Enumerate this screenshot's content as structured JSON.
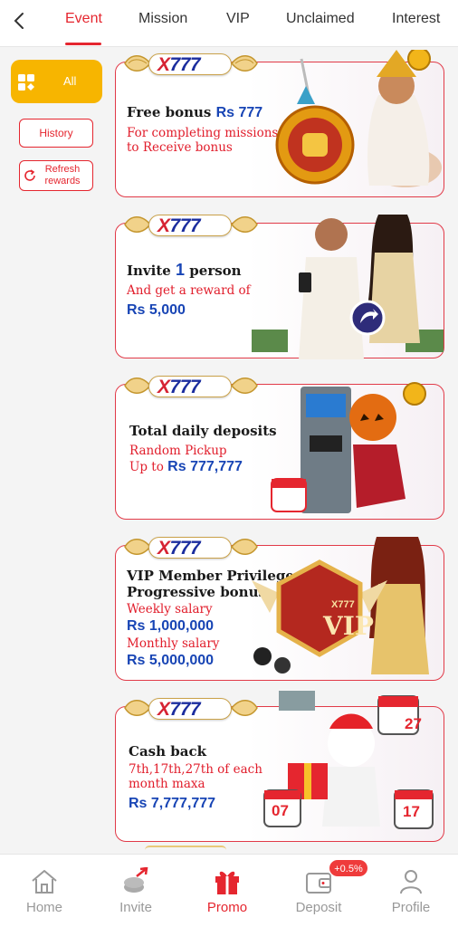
{
  "header": {
    "tabs": [
      {
        "label": "Event",
        "active": true
      },
      {
        "label": "Mission",
        "active": false
      },
      {
        "label": "VIP",
        "active": false
      },
      {
        "label": "Unclaimed",
        "active": false
      },
      {
        "label": "Interest",
        "active": false
      }
    ]
  },
  "sidebar": {
    "all_label": "All",
    "history_label": "History",
    "refresh_label": "Refresh rewards"
  },
  "brand": {
    "prefix": "X",
    "number": "777"
  },
  "cards": [
    {
      "title": "Free bonus",
      "amount": "Rs 777",
      "line1": "For completing missions",
      "line2": "to Receive bonus"
    },
    {
      "title_a": "Invite",
      "count": "1",
      "title_b": "person",
      "line1": "And get a reward of",
      "amount": "Rs 5,000"
    },
    {
      "title": "Total daily deposits",
      "line1": "Random Pickup",
      "line2_prefix": "Up to",
      "amount": "Rs 777,777"
    },
    {
      "title1": "VIP Member Privileges",
      "title2": "Progressive bonus",
      "weekly_label": "Weekly salary",
      "weekly_amount": "Rs 1,000,000",
      "monthly_label": "Monthly salary",
      "monthly_amount": "Rs 5,000,000",
      "badge_brand": "X777",
      "badge_text": "VIP"
    },
    {
      "title": "Cash back",
      "line1": "7th,17th,27th of each",
      "line2": "month maxa",
      "amount": "Rs 7,777,777",
      "cal_dates": [
        "27",
        "07",
        "17"
      ]
    }
  ],
  "bottom_nav": {
    "items": [
      {
        "label": "Home",
        "icon": "house-icon",
        "active": false
      },
      {
        "label": "Invite",
        "icon": "coins-arrow-icon",
        "active": false
      },
      {
        "label": "Promo",
        "icon": "gift-icon",
        "active": true
      },
      {
        "label": "Deposit",
        "icon": "wallet-icon",
        "active": false
      },
      {
        "label": "Profile",
        "icon": "person-icon",
        "active": false
      }
    ],
    "deposit_badge": "+0.5%"
  },
  "colors": {
    "accent": "#e5262f",
    "gold": "#f7b500",
    "blue": "#1845b5"
  }
}
